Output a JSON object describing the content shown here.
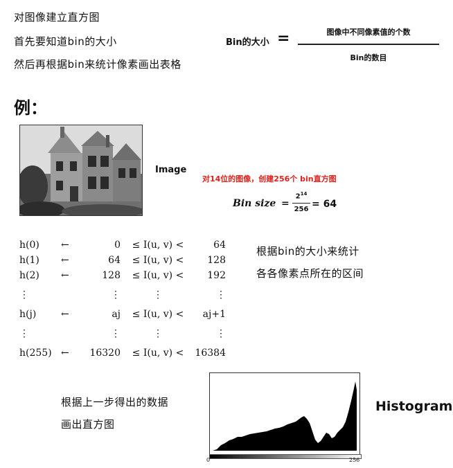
{
  "intro_lines": [
    "对图像建立直方图",
    "首先要知道bin的大小",
    "然后再根据bin来统计像素画出表格"
  ],
  "bin_formula": {
    "lhs": "Bin的大小",
    "eq": "=",
    "numerator": "图像中不同像素值的个数",
    "denominator": "Bin的数目"
  },
  "example_label": "例：",
  "image_label": "Image",
  "red_note": "对14位的图像，创建256个 bin直方图",
  "bin_size": {
    "label": "Bin size",
    "eq": "=",
    "num_base": "2",
    "num_exp": "14",
    "den": "256",
    "result": "= 64"
  },
  "table_rows": [
    {
      "h": "h(0)",
      "arrow": "←",
      "lo": "0",
      "mid": "≤ I(u, v) <",
      "hi": "64"
    },
    {
      "h": "h(1)",
      "arrow": "←",
      "lo": "64",
      "mid": "≤ I(u, v) <",
      "hi": "128"
    },
    {
      "h": "h(2)",
      "arrow": "←",
      "lo": "128",
      "mid": "≤ I(u, v) <",
      "hi": "192"
    },
    {
      "h": "⋮",
      "arrow": "",
      "lo": "⋮",
      "mid": "⋮",
      "hi": "⋮"
    },
    {
      "h": "h(j)",
      "arrow": "←",
      "lo": "aj",
      "mid": "≤ I(u, v) <",
      "hi": "aj+1"
    },
    {
      "h": "⋮",
      "arrow": "",
      "lo": "⋮",
      "mid": "⋮",
      "hi": "⋮"
    },
    {
      "h": "h(255)",
      "arrow": "←",
      "lo": "16320",
      "mid": "≤ I(u, v) <",
      "hi": "16384"
    }
  ],
  "table_note": [
    "根据bin的大小来统计",
    "各各像素点所在的区间"
  ],
  "hist_note": [
    "根据上一步得出的数据",
    "画出直方图"
  ],
  "histogram_label": "Histogram",
  "histogram_axis": {
    "min": "0",
    "max": "256"
  }
}
